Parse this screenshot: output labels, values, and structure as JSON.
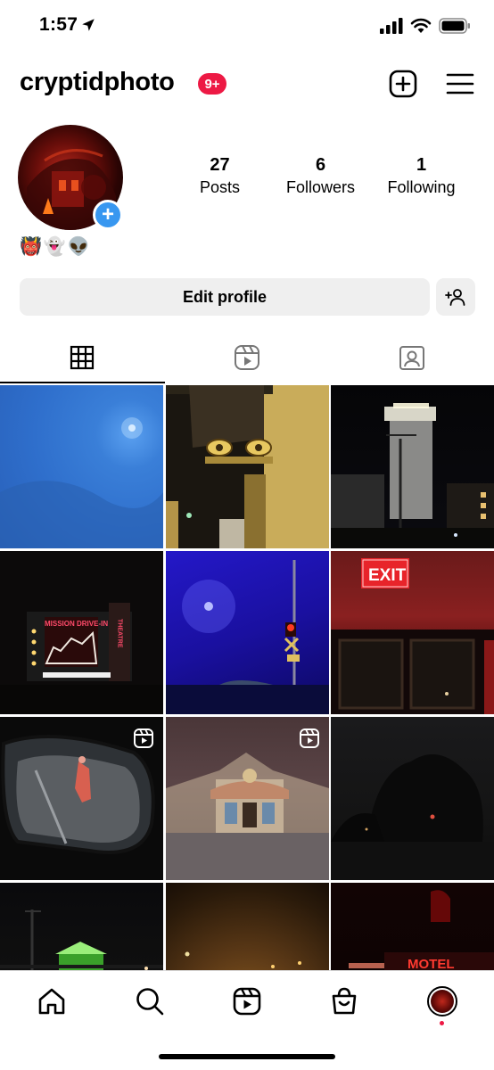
{
  "status_bar": {
    "time": "1:57"
  },
  "header": {
    "username": "cryptidphoto",
    "notification_count": "9+"
  },
  "profile": {
    "stats": [
      {
        "value": "27",
        "label": "Posts"
      },
      {
        "value": "6",
        "label": "Followers"
      },
      {
        "value": "1",
        "label": "Following"
      }
    ],
    "bio_emojis": "👹👻👽",
    "add_story_symbol": "+"
  },
  "actions": {
    "edit_profile_label": "Edit profile"
  },
  "tabs": [
    {
      "name": "grid",
      "icon": "grid-icon",
      "active": true
    },
    {
      "name": "reels",
      "icon": "reels-icon",
      "active": false
    },
    {
      "name": "tagged",
      "icon": "tagged-icon",
      "active": false
    }
  ],
  "grid_posts": [
    {
      "subject": "blue foggy sky with moon",
      "reel": false
    },
    {
      "subject": "storefront with eye sign",
      "reel": false
    },
    {
      "subject": "lit tower at night",
      "reel": false
    },
    {
      "subject": "Mission Drive-In theatre sign",
      "reel": false,
      "sign_text": "MISSION DRIVE-IN",
      "sign_text_2": "THEATRE"
    },
    {
      "subject": "blue light street at night",
      "reel": false
    },
    {
      "subject": "EXIT sign in red glow",
      "reel": false,
      "sign_text": "EXIT"
    },
    {
      "subject": "side mirror reflection",
      "reel": true
    },
    {
      "subject": "building facade at dusk",
      "reel": true
    },
    {
      "subject": "dark trees at night",
      "reel": false
    },
    {
      "subject": "green lit building at night",
      "reel": false
    },
    {
      "subject": "foggy orange street",
      "reel": false
    },
    {
      "subject": "motel neon sign",
      "reel": false,
      "sign_text": "MOTEL"
    }
  ],
  "bottom_nav": [
    "home-icon",
    "search-icon",
    "reels-icon",
    "shop-icon",
    "profile-avatar"
  ],
  "colors": {
    "badge": "#ed1944",
    "add_story": "#3897f0",
    "button_bg": "#efefef"
  }
}
